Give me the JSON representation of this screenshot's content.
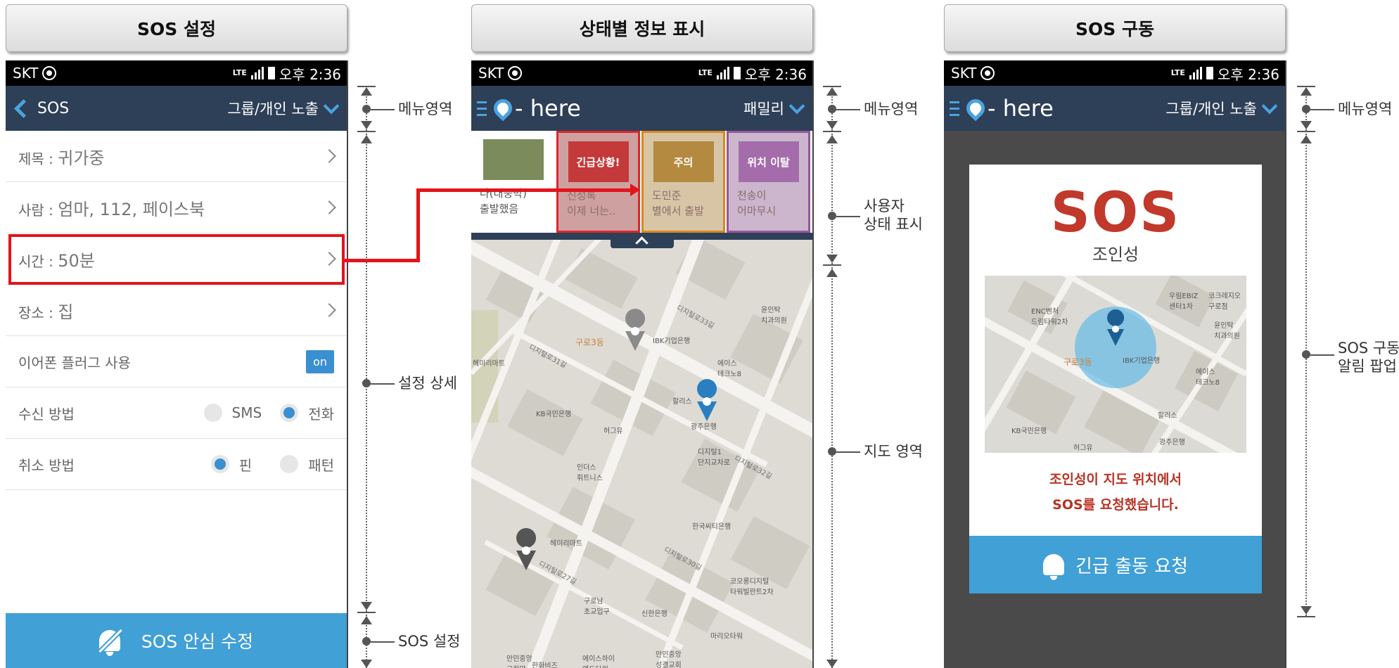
{
  "panels": {
    "left": {
      "title": "SOS 설정"
    },
    "middle": {
      "title": "상태별 정보 표시"
    },
    "right": {
      "title": "SOS 구동"
    }
  },
  "statusbar": {
    "carrier": "SKT",
    "network": "LTE",
    "time": "오후 2:36"
  },
  "settings_screen": {
    "header_title": "SOS",
    "header_action": "그룹/개인 노출",
    "rows": [
      {
        "label": "제목 : ",
        "value": "귀가중"
      },
      {
        "label": "사람 : ",
        "value": "엄마, 112, 페이스북"
      },
      {
        "label": "시간 : ",
        "value": "50분"
      },
      {
        "label": "장소 : ",
        "value": "집"
      }
    ],
    "earphone": {
      "label": "이어폰 플러그 사용",
      "toggle": "on"
    },
    "receive": {
      "label": "수신 방법",
      "options": [
        "SMS",
        "전화"
      ],
      "selected": "전화"
    },
    "cancel": {
      "label": "취소 방법",
      "options": [
        "핀",
        "패턴"
      ],
      "selected": "핀"
    },
    "bottom_button": "SOS 안심 수정"
  },
  "status_screen": {
    "logo_text": "- here",
    "header_action": "패밀리",
    "cards": [
      {
        "badge": "",
        "name": "나(대웅박)",
        "status": "출발했음"
      },
      {
        "badge": "긴급상황!",
        "name": "신성록",
        "status": "이제 너는.."
      },
      {
        "badge": "주의",
        "name": "도민준",
        "status": "별에서 출발"
      },
      {
        "badge": "위치 이탈",
        "name": "천송이",
        "status": "어마무시"
      }
    ],
    "map_labels": {
      "gurodong": "구로3동",
      "ibk": "IBK기업은행",
      "dental": "윤인탁\n치과의원",
      "hemiri": "헤미리마트",
      "aces": "에이스\n테크노8",
      "hollis": "할리스",
      "kb": "KB국민은행",
      "heogeuyu": "허그유",
      "gwangju": "광주은행",
      "digital1": "디지털1\n단지교차로",
      "indeos": "인더스\n휘트니스",
      "citi": "한국씨티은행",
      "hemiri2": "헤미리마트",
      "kolon": "코오롱디지털\n타워빌란트2차",
      "gurochodeung": "구로남\n초교입구",
      "shinhan": "신한은행",
      "marioT": "마리오타워",
      "manmin": "만민중앙\n교회앞",
      "aceshi": "에이스하이\n엔드타워",
      "manmin2": "만민중앙\n성결교회",
      "hanwha": "한화비즈",
      "road33": "디지털로33길",
      "road31": "디지털로31길",
      "road32": "디지털로32길",
      "road30": "디지털로30길",
      "road27": "디지털로27길"
    }
  },
  "sos_screen": {
    "logo_text": "- here",
    "header_action": "그룹/개인 노출",
    "sos_logo": "SOS",
    "name": "조인성",
    "message_line1": "조인성이 지도 위치에서",
    "message_line2": "SOS를 요청했습니다.",
    "button": "긴급 출동 요청",
    "map_labels": {
      "enc": "ENC벤처\n드림타워2차",
      "woori": "우림EBIZ\n센터1차",
      "kokre": "코크레지오\n구로점",
      "dental": "윤인탁\n치과의원",
      "gurodong": "구로3동",
      "ibk": "IBK기업은행",
      "aces": "에이스\n테크노8",
      "hollis": "할리스",
      "kb": "KB국민은행",
      "heogeuyu": "허그유",
      "gwangju": "광주은행"
    }
  },
  "annotations": {
    "left_menu": "메뉴영역",
    "left_detail": "설정 상세",
    "left_sos": "SOS 설정",
    "mid_menu": "메뉴영역",
    "mid_user_1": "사용자",
    "mid_user_2": "상태 표시",
    "mid_map": "지도 영역",
    "right_menu": "메뉴영역",
    "right_sos_1": "SOS 구동",
    "right_sos_2": "알림 팝업"
  },
  "colors": {
    "appbar": "#2e3f58",
    "accent": "#41a0d5",
    "highlight": "#e3141b",
    "urgent": "#d9282b",
    "caution": "#d7891f",
    "leave": "#94579a",
    "sos_red": "#c0392b"
  }
}
